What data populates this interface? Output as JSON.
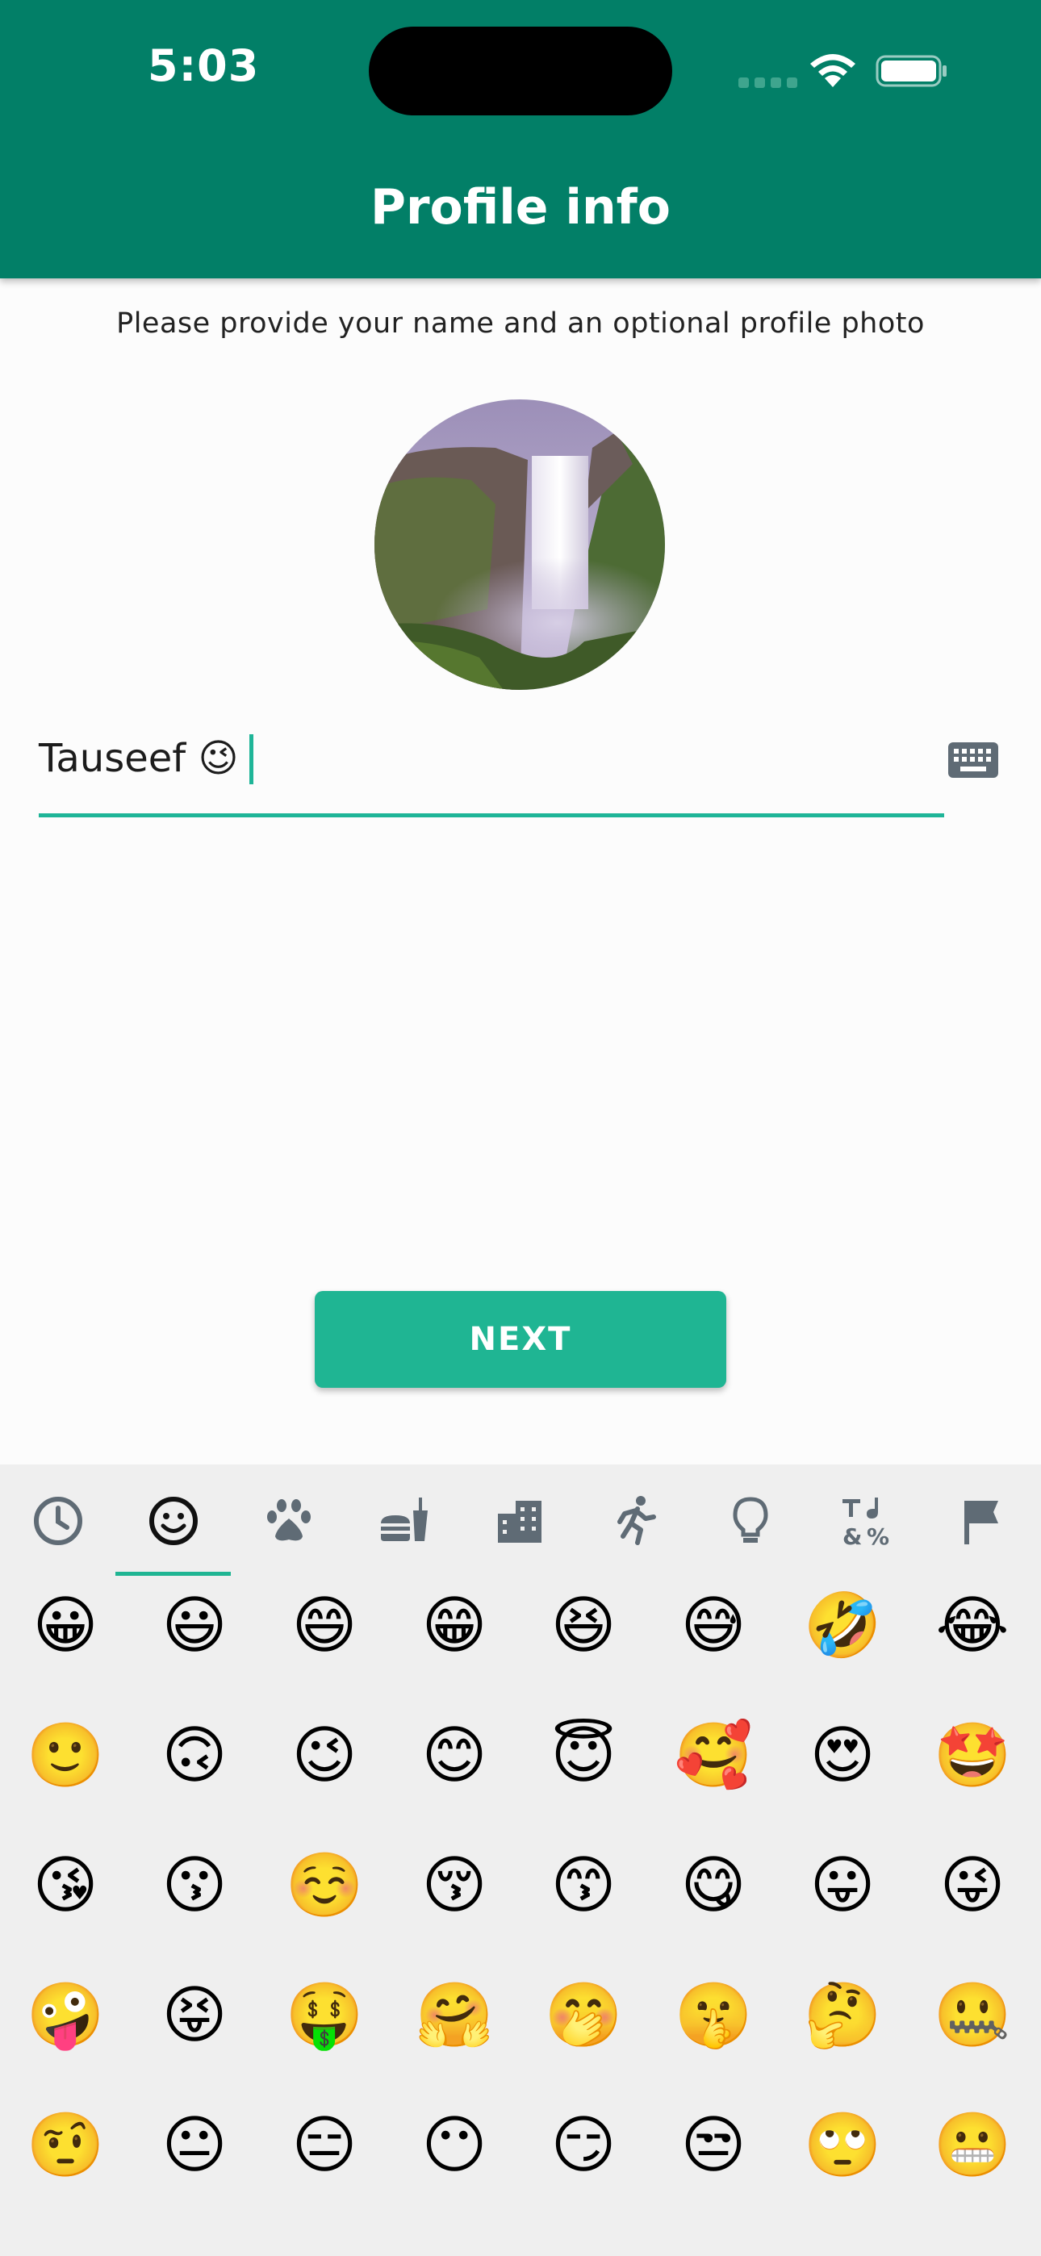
{
  "status_bar": {
    "time": "5:03"
  },
  "header": {
    "title": "Profile info"
  },
  "subtitle": "Please provide your name and an optional profile photo",
  "name_field": {
    "value": "Tauseef 😉"
  },
  "next_button": {
    "label": "NEXT"
  },
  "emoji_categories": [
    {
      "name": "recent",
      "selected": false
    },
    {
      "name": "smileys",
      "selected": true
    },
    {
      "name": "animals",
      "selected": false
    },
    {
      "name": "food",
      "selected": false
    },
    {
      "name": "places",
      "selected": false
    },
    {
      "name": "activities",
      "selected": false
    },
    {
      "name": "objects",
      "selected": false
    },
    {
      "name": "symbols",
      "selected": false
    },
    {
      "name": "flags",
      "selected": false
    }
  ],
  "emoji_rows": [
    [
      "😀",
      "😃",
      "😄",
      "😁",
      "😆",
      "😅",
      "🤣",
      "😂"
    ],
    [
      "🙂",
      "🙃",
      "😉",
      "😊",
      "😇",
      "🥰",
      "😍",
      "🤩"
    ],
    [
      "😘",
      "😗",
      "☺️",
      "😚",
      "😙",
      "😋",
      "😛",
      "😜"
    ],
    [
      "🤪",
      "😝",
      "🤑",
      "🤗",
      "🤭",
      "🤫",
      "🤔",
      "🤐"
    ],
    [
      "🤨",
      "😐",
      "😑",
      "😶",
      "😏",
      "😒",
      "🙄",
      "😬"
    ]
  ],
  "colors": {
    "header": "#027f67",
    "accent": "#1fb593",
    "panel": "#efefef"
  }
}
